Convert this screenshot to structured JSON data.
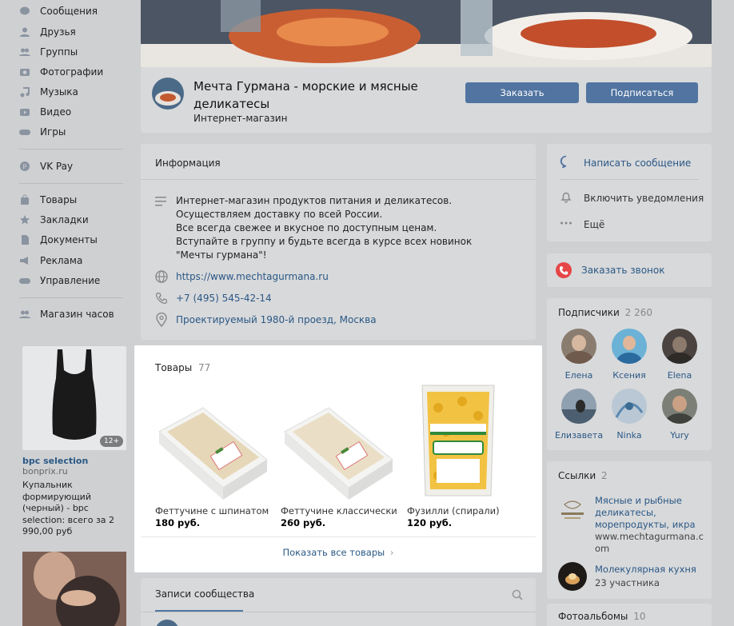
{
  "nav": {
    "items": [
      {
        "label": "Сообщения",
        "icon": "messages-icon"
      },
      {
        "label": "Друзья",
        "icon": "friends-icon"
      },
      {
        "label": "Группы",
        "icon": "groups-icon"
      },
      {
        "label": "Фотографии",
        "icon": "photos-icon"
      },
      {
        "label": "Музыка",
        "icon": "music-icon"
      },
      {
        "label": "Видео",
        "icon": "video-icon"
      },
      {
        "label": "Игры",
        "icon": "games-icon"
      },
      {
        "label": "VK Pay",
        "icon": "vkpay-icon"
      },
      {
        "label": "Товары",
        "icon": "goods-icon"
      },
      {
        "label": "Закладки",
        "icon": "bookmarks-icon"
      },
      {
        "label": "Документы",
        "icon": "documents-icon"
      },
      {
        "label": "Реклама",
        "icon": "ads-icon"
      },
      {
        "label": "Управление",
        "icon": "manage-icon"
      },
      {
        "label": "Магазин часов",
        "icon": "shop-icon"
      }
    ]
  },
  "ads": {
    "first": {
      "title": "bpc selection",
      "domain": "bonprix.ru",
      "text": "Купальник формирующий (черный) - bpc selection: всего за 2 990,00 руб",
      "age": "12+"
    }
  },
  "group": {
    "name": "Мечта Гурмана - морские и мясные деликатесы",
    "category": "Интернет-магазин",
    "order_label": "Заказать",
    "subscribe_label": "Подписаться"
  },
  "info": {
    "title": "Информация",
    "description": "Интернет-магазин продуктов питания и деликатесов.\nОсуществляем доставку по всей России.\nВсе всегда свежее и вкусное по доступным ценам.\nВступайте в группу и будьте всегда в курсе всех новинок \"Мечты гурмана\"!",
    "site": "https://www.mechtagurmana.ru",
    "phone": "+7 (495) 545-42-14",
    "address": "Проектируемый 1980-й проезд, Москва"
  },
  "goods": {
    "title": "Товары",
    "count": "77",
    "items": [
      {
        "name": "Феттучине с шпинатом",
        "price": "180 руб."
      },
      {
        "name": "Феттучине классически...",
        "price": "260 руб."
      },
      {
        "name": "Фузилли (спирали)",
        "price": "120 руб."
      }
    ],
    "show_all": "Показать все товары"
  },
  "wall": {
    "title": "Записи сообщества"
  },
  "actions": {
    "write": "Написать сообщение",
    "notify": "Включить уведомления",
    "more": "Ещё",
    "call": "Заказать звонок"
  },
  "subscribers": {
    "title": "Подписчики",
    "count": "2 260",
    "people": [
      "Елена",
      "Ксения",
      "Elena",
      "Елизавета",
      "Ninka",
      "Yury"
    ]
  },
  "links": {
    "title": "Ссылки",
    "count": "2",
    "items": [
      {
        "title": "Мясные и рыбные деликатесы, морепродукты, икра",
        "sub": "www.mechtagurmana.com"
      },
      {
        "title": "Молекулярная кухня",
        "sub": "23 участника"
      }
    ]
  },
  "albums": {
    "title": "Фотоальбомы",
    "count": "10"
  },
  "colors": {
    "accent": "#5174a1",
    "link": "#2a5885",
    "call_red": "#e64646"
  }
}
